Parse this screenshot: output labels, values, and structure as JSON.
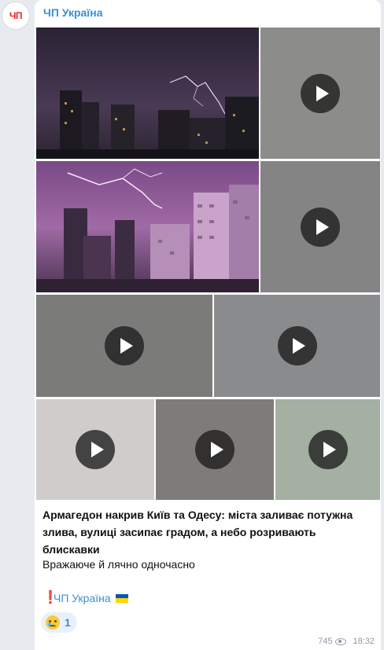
{
  "channel": {
    "avatar_text": "ЧП",
    "name": "ЧП Україна"
  },
  "post": {
    "headline": "Армагедон накрив Київ та Одесу: міста заливає потужна злива, вулиці засипає градом, а небо розривають блискавки",
    "body": "Вражаюче й лячно одночасно",
    "signature_mark": "❗",
    "signature_link": "ЧП Україна",
    "flag_colors": {
      "top": "#0057b7",
      "bottom": "#ffd700"
    }
  },
  "media": {
    "photo_1": {
      "type": "photo",
      "icon": "none"
    },
    "video_1": {
      "type": "video",
      "icon": "play-icon"
    },
    "photo_2": {
      "type": "photo",
      "icon": "none"
    },
    "video_2": {
      "type": "video",
      "icon": "play-icon"
    },
    "video_3": {
      "type": "video",
      "icon": "play-icon"
    },
    "video_4": {
      "type": "video",
      "icon": "play-icon"
    },
    "video_5": {
      "type": "video",
      "icon": "play-icon"
    },
    "video_6": {
      "type": "video",
      "icon": "play-icon"
    },
    "video_7": {
      "type": "video",
      "icon": "play-icon"
    }
  },
  "reactions": [
    {
      "emoji": "crying-face-icon",
      "count": "1"
    }
  ],
  "footer": {
    "views": "745",
    "time": "18:32"
  },
  "colors": {
    "accent": "#3a8fd4",
    "background": "#e7ebf0",
    "bubble": "#ffffff"
  }
}
